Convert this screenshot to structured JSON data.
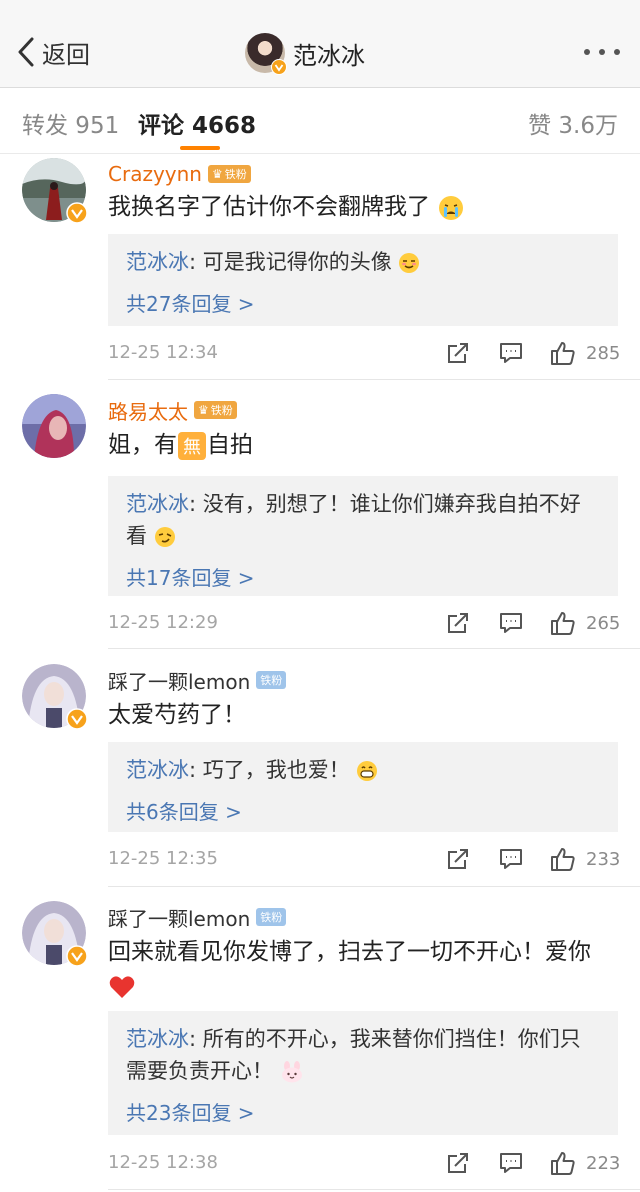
{
  "nav": {
    "back_label": "返回",
    "title": "范冰冰"
  },
  "tabs": {
    "repost": "转发 951",
    "comments": "评论 4668",
    "likes": "赞 3.6万"
  },
  "comments": [
    {
      "username": "Crazyynn",
      "badge": "铁粉",
      "text": "我换名字了估计你不会翻牌我了",
      "reply_author": "范冰冰",
      "reply_text": ": 可是我记得你的头像",
      "reply_count": "共27条回复 >",
      "time": "12-25 12:34",
      "likes": "285"
    },
    {
      "username": "路易太太",
      "badge": "铁粉",
      "text_a": "姐，有",
      "text_b": "自拍",
      "reply_author": "范冰冰",
      "reply_text": ": 没有，别想了！谁让你们嫌弃我自拍不好看",
      "reply_count": "共17条回复 >",
      "time": "12-25 12:29",
      "likes": "265"
    },
    {
      "username": "踩了一颗lemon",
      "badge": "铁粉",
      "text": "太爱芍药了！",
      "reply_author": "范冰冰",
      "reply_text": ": 巧了，我也爱！",
      "reply_count": "共6条回复 >",
      "time": "12-25 12:35",
      "likes": "233"
    },
    {
      "username": "踩了一颗lemon",
      "badge": "铁粉",
      "text": "回来就看见你发博了，扫去了一切不开心！爱你",
      "reply_author": "范冰冰",
      "reply_text": ": 所有的不开心，我来替你们挡住！你们只需要负责开心！",
      "reply_count": "共23条回复 >",
      "time": "12-25 12:38",
      "likes": "223"
    }
  ],
  "icons": {
    "nav_back": "chevron-left-icon",
    "nav_more": "more-dots-icon",
    "verified": "verified-badge-icon",
    "share": "share-icon",
    "reply": "comment-icon",
    "like": "thumbs-up-icon"
  },
  "colors": {
    "accent": "#ff8200",
    "link": "#4a77b3",
    "vip_name": "#e86b0f"
  }
}
